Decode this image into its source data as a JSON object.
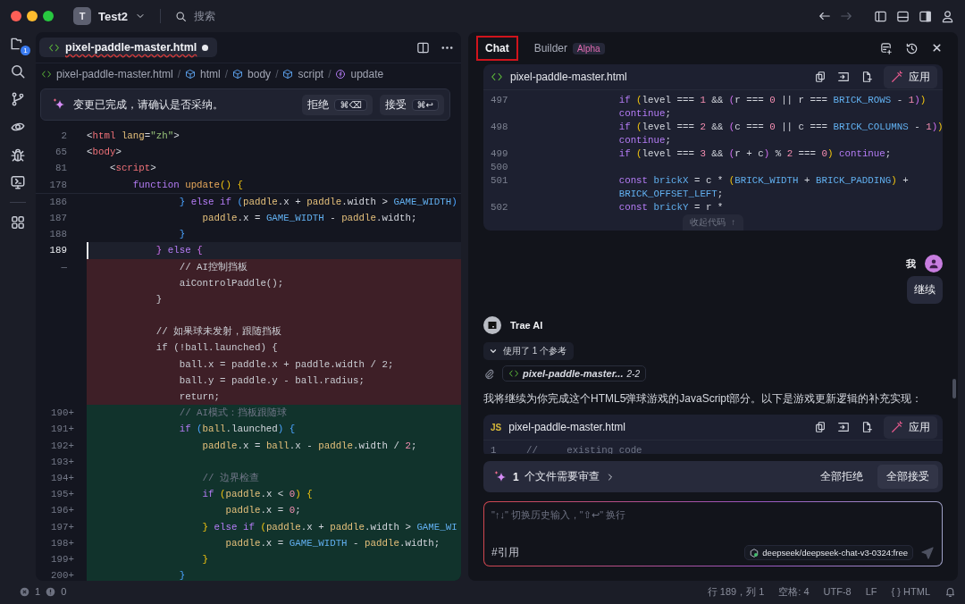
{
  "window": {
    "avatar": "T",
    "title": "Test2",
    "search_placeholder": "搜索"
  },
  "activity_bar": {
    "badge": "1"
  },
  "editor": {
    "tab": {
      "label": "pixel-paddle-master.html",
      "modified": true
    },
    "breadcrumb_separator": "/",
    "breadcrumbs": [
      {
        "label": "pixel-paddle-master.html",
        "kind": "file"
      },
      {
        "label": "html",
        "kind": "element"
      },
      {
        "label": "body",
        "kind": "element"
      },
      {
        "label": "script",
        "kind": "element"
      },
      {
        "label": "update",
        "kind": "function"
      }
    ],
    "banner": {
      "message": "变更已完成，请确认是否采纳。",
      "buttons": [
        {
          "label": "拒绝",
          "shortcut": "⌘⌫"
        },
        {
          "label": "接受",
          "shortcut": "⌘↩"
        }
      ]
    },
    "lines": [
      {
        "number": "2",
        "kind": "sticky",
        "tokens": [
          {
            "kind": "plain",
            "text": "<"
          },
          {
            "kind": "tag",
            "text": "html"
          },
          {
            "kind": "attr",
            "text": " lang"
          },
          {
            "kind": "plain",
            "text": "="
          },
          {
            "kind": "string",
            "text": "\"zh\""
          },
          {
            "kind": "plain",
            "text": ">"
          }
        ]
      },
      {
        "number": "65",
        "kind": "sticky",
        "tokens": [
          {
            "kind": "plain",
            "text": "<"
          },
          {
            "kind": "tag",
            "text": "body"
          },
          {
            "kind": "plain",
            "text": ">"
          }
        ]
      },
      {
        "number": "81",
        "kind": "sticky",
        "tokens": [
          {
            "kind": "plain",
            "text": "    <"
          },
          {
            "kind": "tag",
            "text": "script"
          },
          {
            "kind": "plain",
            "text": ">"
          }
        ]
      },
      {
        "number": "178",
        "kind": "sticky",
        "tokens": [
          {
            "kind": "keyword",
            "text": "        function "
          },
          {
            "kind": "function",
            "text": "update"
          },
          {
            "kind": "paren1",
            "text": "() {"
          }
        ]
      },
      {
        "number": "186",
        "kind": "context",
        "tokens": [
          {
            "kind": "paren2",
            "text": "                } "
          },
          {
            "kind": "keyword",
            "text": "else if "
          },
          {
            "kind": "paren2",
            "text": "("
          },
          {
            "kind": "var",
            "text": "paddle"
          },
          {
            "kind": "plain",
            "text": ".x + "
          },
          {
            "kind": "var",
            "text": "paddle"
          },
          {
            "kind": "plain",
            "text": ".width > "
          },
          {
            "kind": "const",
            "text": "GAME_WIDTH"
          },
          {
            "kind": "paren2",
            "text": ")"
          }
        ]
      },
      {
        "number": "187",
        "kind": "context",
        "tokens": [
          {
            "kind": "var",
            "text": "                    paddle"
          },
          {
            "kind": "plain",
            "text": ".x = "
          },
          {
            "kind": "const",
            "text": "GAME_WIDTH"
          },
          {
            "kind": "plain",
            "text": " - "
          },
          {
            "kind": "var",
            "text": "paddle"
          },
          {
            "kind": "plain",
            "text": ".width;"
          }
        ]
      },
      {
        "number": "188",
        "kind": "context",
        "tokens": [
          {
            "kind": "paren2",
            "text": "                }"
          }
        ]
      },
      {
        "number": "189",
        "kind": "current",
        "tokens": [
          {
            "kind": "paren3",
            "text": "            } "
          },
          {
            "kind": "keyword",
            "text": "else "
          },
          {
            "kind": "paren3",
            "text": "{"
          }
        ]
      },
      {
        "number": "—",
        "kind": "removed",
        "tokens": [
          {
            "kind": "plain",
            "text": "                // AI控制挡板"
          }
        ]
      },
      {
        "kind": "removed",
        "tokens": [
          {
            "kind": "plain",
            "text": "                aiControlPaddle();"
          }
        ]
      },
      {
        "kind": "removed",
        "tokens": [
          {
            "kind": "plain",
            "text": "            }"
          }
        ]
      },
      {
        "kind": "removed"
      },
      {
        "kind": "removed",
        "tokens": [
          {
            "kind": "plain",
            "text": "            // 如果球未发射，跟随挡板"
          }
        ]
      },
      {
        "kind": "removed",
        "tokens": [
          {
            "kind": "plain",
            "text": "            if (!ball.launched) {"
          }
        ]
      },
      {
        "kind": "removed",
        "tokens": [
          {
            "kind": "plain",
            "text": "                ball.x = paddle.x + paddle.width / 2;"
          }
        ]
      },
      {
        "kind": "removed",
        "tokens": [
          {
            "kind": "plain",
            "text": "                ball.y = paddle.y - ball.radius;"
          }
        ]
      },
      {
        "kind": "removed",
        "tokens": [
          {
            "kind": "plain",
            "text": "                return;"
          }
        ]
      },
      {
        "number": "190+",
        "kind": "added",
        "tokens": [
          {
            "kind": "comment",
            "text": "                // AI模式：挡板跟随球"
          }
        ]
      },
      {
        "number": "191+",
        "kind": "added",
        "tokens": [
          {
            "kind": "keyword",
            "text": "                if "
          },
          {
            "kind": "paren2",
            "text": "("
          },
          {
            "kind": "var",
            "text": "ball"
          },
          {
            "kind": "plain",
            "text": ".launched"
          },
          {
            "kind": "paren2",
            "text": ") {"
          }
        ]
      },
      {
        "number": "192+",
        "kind": "added",
        "tokens": [
          {
            "kind": "var",
            "text": "                    paddle"
          },
          {
            "kind": "plain",
            "text": ".x = "
          },
          {
            "kind": "var",
            "text": "ball"
          },
          {
            "kind": "plain",
            "text": ".x - "
          },
          {
            "kind": "var",
            "text": "paddle"
          },
          {
            "kind": "plain",
            "text": ".width / "
          },
          {
            "kind": "number",
            "text": "2"
          },
          {
            "kind": "plain",
            "text": ";"
          }
        ]
      },
      {
        "number": "193+",
        "kind": "added"
      },
      {
        "number": "194+",
        "kind": "added",
        "tokens": [
          {
            "kind": "comment",
            "text": "                    // 边界检查"
          }
        ]
      },
      {
        "number": "195+",
        "kind": "added",
        "tokens": [
          {
            "kind": "keyword",
            "text": "                    if "
          },
          {
            "kind": "paren1",
            "text": "("
          },
          {
            "kind": "var",
            "text": "paddle"
          },
          {
            "kind": "plain",
            "text": ".x < "
          },
          {
            "kind": "number",
            "text": "0"
          },
          {
            "kind": "paren1",
            "text": ") {"
          }
        ]
      },
      {
        "number": "196+",
        "kind": "added",
        "tokens": [
          {
            "kind": "var",
            "text": "                        paddle"
          },
          {
            "kind": "plain",
            "text": ".x = "
          },
          {
            "kind": "number",
            "text": "0"
          },
          {
            "kind": "plain",
            "text": ";"
          }
        ]
      },
      {
        "number": "197+",
        "kind": "added",
        "tokens": [
          {
            "kind": "paren1",
            "text": "                    } "
          },
          {
            "kind": "keyword",
            "text": "else if "
          },
          {
            "kind": "paren1",
            "text": "("
          },
          {
            "kind": "var",
            "text": "paddle"
          },
          {
            "kind": "plain",
            "text": ".x + "
          },
          {
            "kind": "var",
            "text": "paddle"
          },
          {
            "kind": "plain",
            "text": ".width > "
          },
          {
            "kind": "const",
            "text": "GAME_WI"
          }
        ]
      },
      {
        "number": "198+",
        "kind": "added",
        "tokens": [
          {
            "kind": "var",
            "text": "                        paddle"
          },
          {
            "kind": "plain",
            "text": ".x = "
          },
          {
            "kind": "const",
            "text": "GAME_WIDTH"
          },
          {
            "kind": "plain",
            "text": " - "
          },
          {
            "kind": "var",
            "text": "paddle"
          },
          {
            "kind": "plain",
            "text": ".width;"
          }
        ]
      },
      {
        "number": "199+",
        "kind": "added",
        "tokens": [
          {
            "kind": "paren1",
            "text": "                    }"
          }
        ]
      },
      {
        "number": "200+",
        "kind": "added",
        "tokens": [
          {
            "kind": "paren2",
            "text": "                }"
          }
        ]
      }
    ]
  },
  "chat": {
    "tabs": [
      {
        "label": "Chat",
        "selected": true
      },
      {
        "label": "Builder",
        "selected": false,
        "badge": "Alpha"
      }
    ],
    "code_block": {
      "filename": "pixel-paddle-master.html",
      "kind": "html",
      "apply": "应用",
      "collapse": "收起代码 ↑",
      "lines": [
        {
          "number": "497",
          "tokens": [
            {
              "kind": "keyword",
              "text": "                if "
            },
            {
              "kind": "paren1",
              "text": "("
            },
            {
              "kind": "plain",
              "text": "level === "
            },
            {
              "kind": "number",
              "text": "1"
            },
            {
              "kind": "plain",
              "text": " && "
            },
            {
              "kind": "paren3",
              "text": "("
            },
            {
              "kind": "plain",
              "text": "r === "
            },
            {
              "kind": "number",
              "text": "0"
            },
            {
              "kind": "plain",
              "text": " || r === "
            },
            {
              "kind": "const",
              "text": "BRICK_ROWS"
            },
            {
              "kind": "plain",
              "text": " - "
            },
            {
              "kind": "number",
              "text": "1"
            },
            {
              "kind": "paren3",
              "text": ")"
            },
            {
              "kind": "paren1",
              "text": ")"
            }
          ]
        },
        {
          "tokens": [
            {
              "kind": "keyword",
              "text": "                continue"
            },
            {
              "kind": "plain",
              "text": ";"
            }
          ]
        },
        {
          "number": "498",
          "tokens": [
            {
              "kind": "keyword",
              "text": "                if "
            },
            {
              "kind": "paren1",
              "text": "("
            },
            {
              "kind": "plain",
              "text": "level === "
            },
            {
              "kind": "number",
              "text": "2"
            },
            {
              "kind": "plain",
              "text": " && "
            },
            {
              "kind": "paren3",
              "text": "("
            },
            {
              "kind": "plain",
              "text": "c === "
            },
            {
              "kind": "number",
              "text": "0"
            },
            {
              "kind": "plain",
              "text": " || c === "
            },
            {
              "kind": "const",
              "text": "BRICK_COLUMNS"
            },
            {
              "kind": "plain",
              "text": " - "
            },
            {
              "kind": "number",
              "text": "1"
            },
            {
              "kind": "paren3",
              "text": ")"
            },
            {
              "kind": "paren1",
              "text": ")"
            }
          ]
        },
        {
          "tokens": [
            {
              "kind": "keyword",
              "text": "                continue"
            },
            {
              "kind": "plain",
              "text": ";"
            }
          ]
        },
        {
          "number": "499",
          "tokens": [
            {
              "kind": "keyword",
              "text": "                if "
            },
            {
              "kind": "paren1",
              "text": "("
            },
            {
              "kind": "plain",
              "text": "level === "
            },
            {
              "kind": "number",
              "text": "3"
            },
            {
              "kind": "plain",
              "text": " && "
            },
            {
              "kind": "paren3",
              "text": "("
            },
            {
              "kind": "plain",
              "text": "r + c"
            },
            {
              "kind": "paren3",
              "text": ")"
            },
            {
              "kind": "plain",
              "text": " % "
            },
            {
              "kind": "number",
              "text": "2"
            },
            {
              "kind": "plain",
              "text": " === "
            },
            {
              "kind": "number",
              "text": "0"
            },
            {
              "kind": "paren1",
              "text": ") "
            },
            {
              "kind": "keyword",
              "text": "continue"
            },
            {
              "kind": "plain",
              "text": ";"
            }
          ]
        },
        {
          "number": "500"
        },
        {
          "number": "501",
          "tokens": [
            {
              "kind": "keyword",
              "text": "                const "
            },
            {
              "kind": "const",
              "text": "brickX"
            },
            {
              "kind": "plain",
              "text": " = c * "
            },
            {
              "kind": "paren1",
              "text": "("
            },
            {
              "kind": "const",
              "text": "BRICK_WIDTH"
            },
            {
              "kind": "plain",
              "text": " + "
            },
            {
              "kind": "const",
              "text": "BRICK_PADDING"
            },
            {
              "kind": "paren1",
              "text": ")"
            },
            {
              "kind": "plain",
              "text": " +"
            }
          ]
        },
        {
          "tokens": [
            {
              "kind": "const",
              "text": "                BRICK_OFFSET_LEFT"
            },
            {
              "kind": "plain",
              "text": ";"
            }
          ]
        },
        {
          "number": "502",
          "tokens": [
            {
              "kind": "keyword",
              "text": "                const "
            },
            {
              "kind": "const",
              "text": "brickY"
            },
            {
              "kind": "plain",
              "text": " = r *"
            }
          ]
        }
      ]
    },
    "messages": [
      {
        "kind": "user",
        "author": "我",
        "text": "继续"
      },
      {
        "kind": "assistant",
        "author": "Trae AI",
        "references_label": "使用了 1 个参考",
        "reference": {
          "file": "pixel-paddle-master...",
          "range": "2-2"
        },
        "text": "我将继续为你完成这个HTML5弹球游戏的JavaScript部分。以下是游戏更新逻辑的补充实现：",
        "code_block": {
          "filename": "pixel-paddle-master.html",
          "kind": "js",
          "badge": "JS",
          "apply": "应用",
          "lines": [
            {
              "number": "1",
              "tokens": [
                {
                  "kind": "comment",
                  "text": "//     existing code"
                }
              ]
            }
          ]
        }
      }
    ],
    "review": {
      "count": "1",
      "label": "个文件需要审查",
      "reject_all": "全部拒绝",
      "accept_all": "全部接受"
    },
    "input": {
      "placeholder": "\"↑↓\" 切换历史输入，\"⇧↩\" 换行",
      "reference": "#引用",
      "model": "deepseek/deepseek-chat-v3-0324:free"
    }
  },
  "status_bar": {
    "errors": "1",
    "warnings": "0",
    "items": [
      "行 189，列 1",
      "空格: 4",
      "UTF-8",
      "LF",
      "{ } HTML"
    ]
  }
}
